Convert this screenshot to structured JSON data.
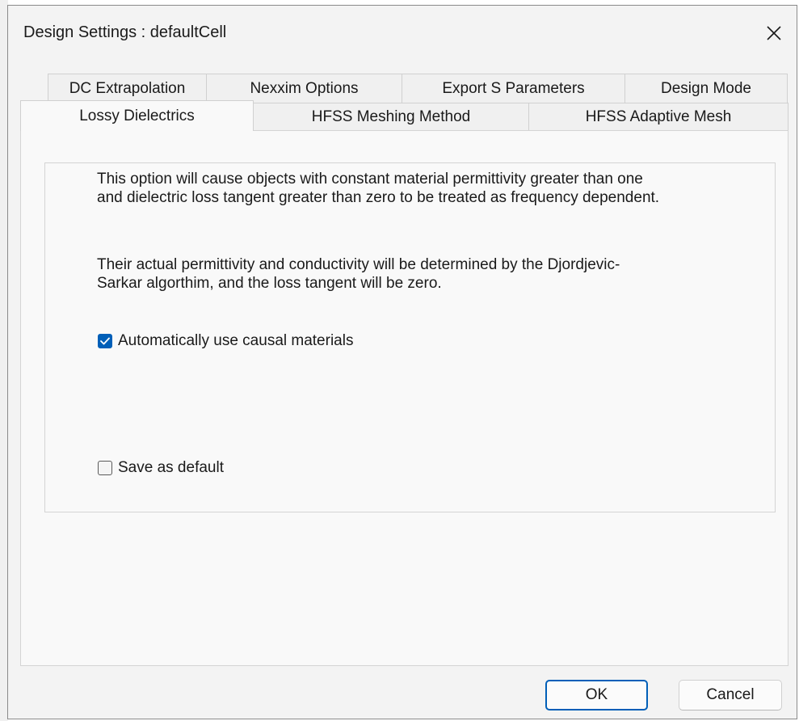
{
  "window": {
    "title": "Design Settings : defaultCell"
  },
  "tabs": {
    "row_top": [
      {
        "label": "DC Extrapolation"
      },
      {
        "label": "Nexxim Options"
      },
      {
        "label": "Export S Parameters"
      },
      {
        "label": "Design Mode"
      }
    ],
    "row_bottom": [
      {
        "label": "Lossy Dielectrics",
        "active": true
      },
      {
        "label": "HFSS Meshing Method"
      },
      {
        "label": "HFSS Adaptive Mesh"
      }
    ]
  },
  "panel": {
    "paragraph1": "This option will cause objects with constant material permittivity greater than one and dielectric loss tangent greater than zero to be treated as frequency dependent.",
    "paragraph2": "Their actual permittivity and conductivity will be determined by the Djordjevic-Sarkar algorthim, and the loss tangent will be zero.",
    "causal_checkbox": {
      "label": "Automatically use causal materials",
      "checked": true
    },
    "default_checkbox": {
      "label": "Save as default",
      "checked": false
    }
  },
  "buttons": {
    "ok": "OK",
    "cancel": "Cancel"
  },
  "colors": {
    "accent": "#005fb8",
    "dialog_bg": "#f3f3f3",
    "panel_bg": "#f9f9f9"
  },
  "icons": {
    "close": "close-icon",
    "check": "checkmark-icon"
  }
}
